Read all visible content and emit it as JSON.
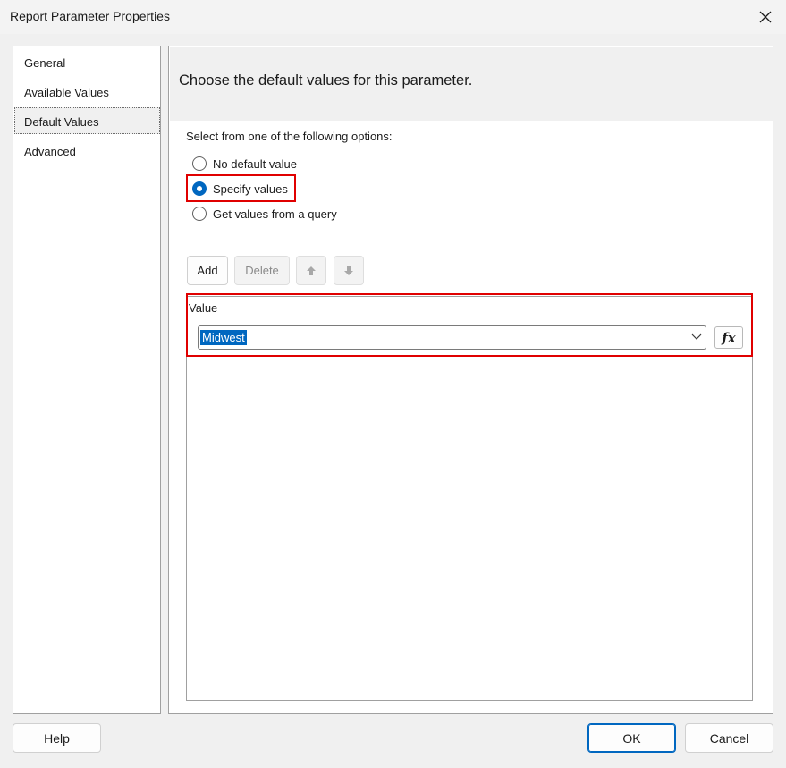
{
  "window": {
    "title": "Report Parameter Properties"
  },
  "sidebar": {
    "items": [
      {
        "label": "General"
      },
      {
        "label": "Available Values"
      },
      {
        "label": "Default Values"
      },
      {
        "label": "Advanced"
      }
    ],
    "active_index": 2
  },
  "panel": {
    "header": "Choose the default values for this parameter.",
    "instruction": "Select from one of the following options:",
    "options": [
      {
        "label": "No default value",
        "selected": false
      },
      {
        "label": "Specify values",
        "selected": true
      },
      {
        "label": "Get values from a query",
        "selected": false
      }
    ],
    "toolbar": {
      "add": "Add",
      "delete": "Delete"
    },
    "grid": {
      "column_header": "Value",
      "rows": [
        {
          "value": "Midwest"
        }
      ]
    },
    "expression_button": "fx"
  },
  "footer": {
    "help": "Help",
    "ok": "OK",
    "cancel": "Cancel"
  },
  "colors": {
    "accent": "#0067c0",
    "highlight_border": "#e00000"
  },
  "icons": [
    "close-icon",
    "move-up-icon",
    "move-down-icon",
    "chevron-down-icon",
    "expression-fx-icon"
  ]
}
